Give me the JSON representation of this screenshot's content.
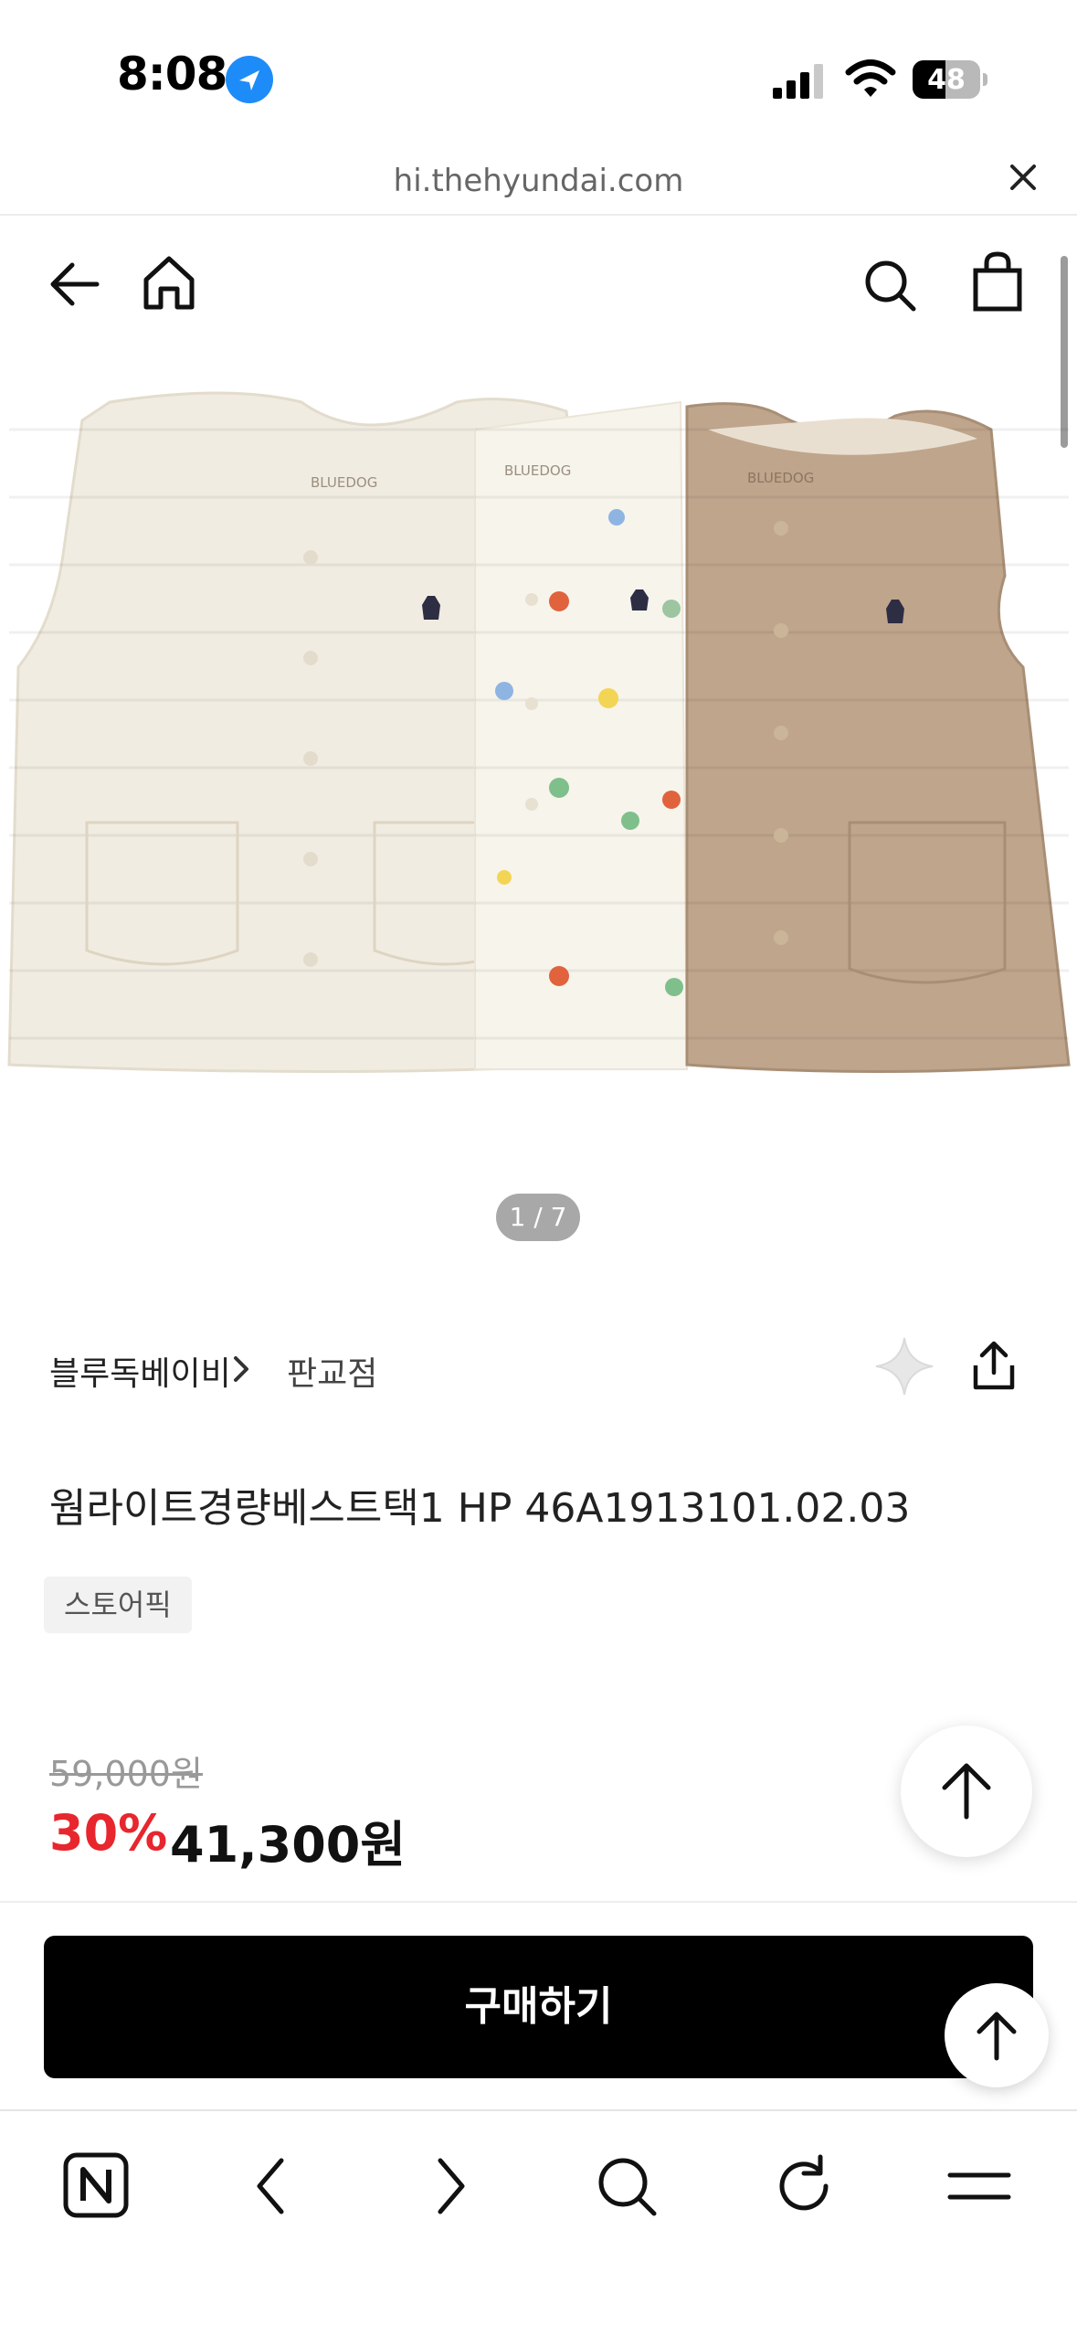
{
  "status_bar": {
    "time": "8:08",
    "battery_level": "48",
    "battery_fraction": 0.48,
    "icons": [
      "location-arrow-icon",
      "cellular-signal-icon",
      "wifi-icon",
      "battery-icon"
    ]
  },
  "browser": {
    "url": "hi.thehyundai.com",
    "close_icon": "close-icon"
  },
  "site_header": {
    "left_icons": [
      "back-arrow-icon",
      "home-icon"
    ],
    "right_icons": [
      "search-icon",
      "shopping-bag-icon"
    ]
  },
  "product": {
    "image_alt": "BLUEDOG quilted vests",
    "image_counter": "1 / 7",
    "brand": "블루독베이비",
    "store": "판교점",
    "title": "웜라이트경량베스트택1 HP 46A1913101.02.03",
    "badge": "스토어픽",
    "original_price": "59,000원",
    "discount_rate": "30%",
    "sale_price": "41,300원",
    "image_print": "BLUEDOG",
    "colors": {
      "ivory": "#f1ece1",
      "pattern": "#f7f4ec",
      "beige": "#bfa58c"
    }
  },
  "actions": {
    "buy_label": "구매하기",
    "wish_icon": "sparkle-icon",
    "share_icon": "share-icon",
    "scroll_top_icon": "arrow-up-icon"
  },
  "browser_toolbar": {
    "items": [
      "naver-n-icon",
      "back-chevron-icon",
      "forward-chevron-icon",
      "search-icon",
      "refresh-icon",
      "menu-icon"
    ]
  },
  "theme": {
    "accent_red": "#e8262d",
    "button_black": "#000000",
    "ios_blue": "#1d8cf8"
  }
}
